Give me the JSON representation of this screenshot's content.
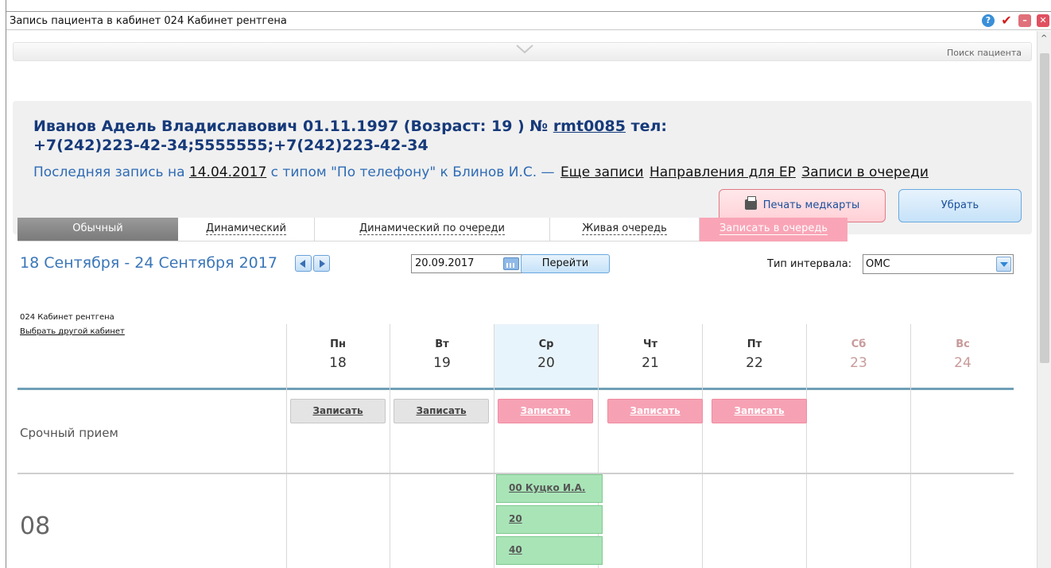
{
  "window": {
    "title": "Запись пациента в кабинет 024 Кабинет рентгена"
  },
  "header": {
    "search_link": "Поиск пациента"
  },
  "patient": {
    "name_prefix": "Иванов Адель Владиславович 01.11.1997 (Возраст: 19 ) №",
    "card_number": "rmt0085",
    "phone_label": "тел:",
    "phones": "+7(242)223-42-34;5555555;+7(242)223-42-34",
    "last_prefix": "Последняя запись на",
    "last_date": "14.04.2017",
    "last_suffix": "с типом \"По телефону\" к Блинов И.С. —",
    "link_more": "Еще записи",
    "link_directions": "Направления для ЕР",
    "link_queue": "Записи в очереди",
    "print_button": "Печать медкарты",
    "remove_button": "Убрать"
  },
  "tabs": [
    {
      "label": "Обычный"
    },
    {
      "label": "Динамический"
    },
    {
      "label": "Динамический по очереди"
    },
    {
      "label": "Живая очередь"
    },
    {
      "label": "Записать в очередь"
    }
  ],
  "toolbar": {
    "week_range": "18 Сентября - 24 Сентября 2017",
    "date_value": "20.09.2017",
    "go_button": "Перейти",
    "interval_label": "Тип интервала:",
    "interval_value": "ОМС"
  },
  "schedule": {
    "cabinet": "024 Кабинет рентгена",
    "change_cabinet": "Выбрать другой кабинет",
    "days": [
      {
        "name": "Пн",
        "num": "18"
      },
      {
        "name": "Вт",
        "num": "19"
      },
      {
        "name": "Ср",
        "num": "20"
      },
      {
        "name": "Чт",
        "num": "21"
      },
      {
        "name": "Пт",
        "num": "22"
      },
      {
        "name": "Сб",
        "num": "23"
      },
      {
        "name": "Вс",
        "num": "24"
      }
    ],
    "urgent_label": "Срочный прием",
    "book_label": "Записать",
    "hour": "08",
    "slots": [
      {
        "text": "00 Куцко И.А."
      },
      {
        "text": "20"
      },
      {
        "text": "40"
      }
    ]
  },
  "colors": {
    "accent_blue": "#3a76b8",
    "pink": "#f6a2b4",
    "slot_green": "#a9e4b7",
    "rule": "#6f9fb7"
  }
}
